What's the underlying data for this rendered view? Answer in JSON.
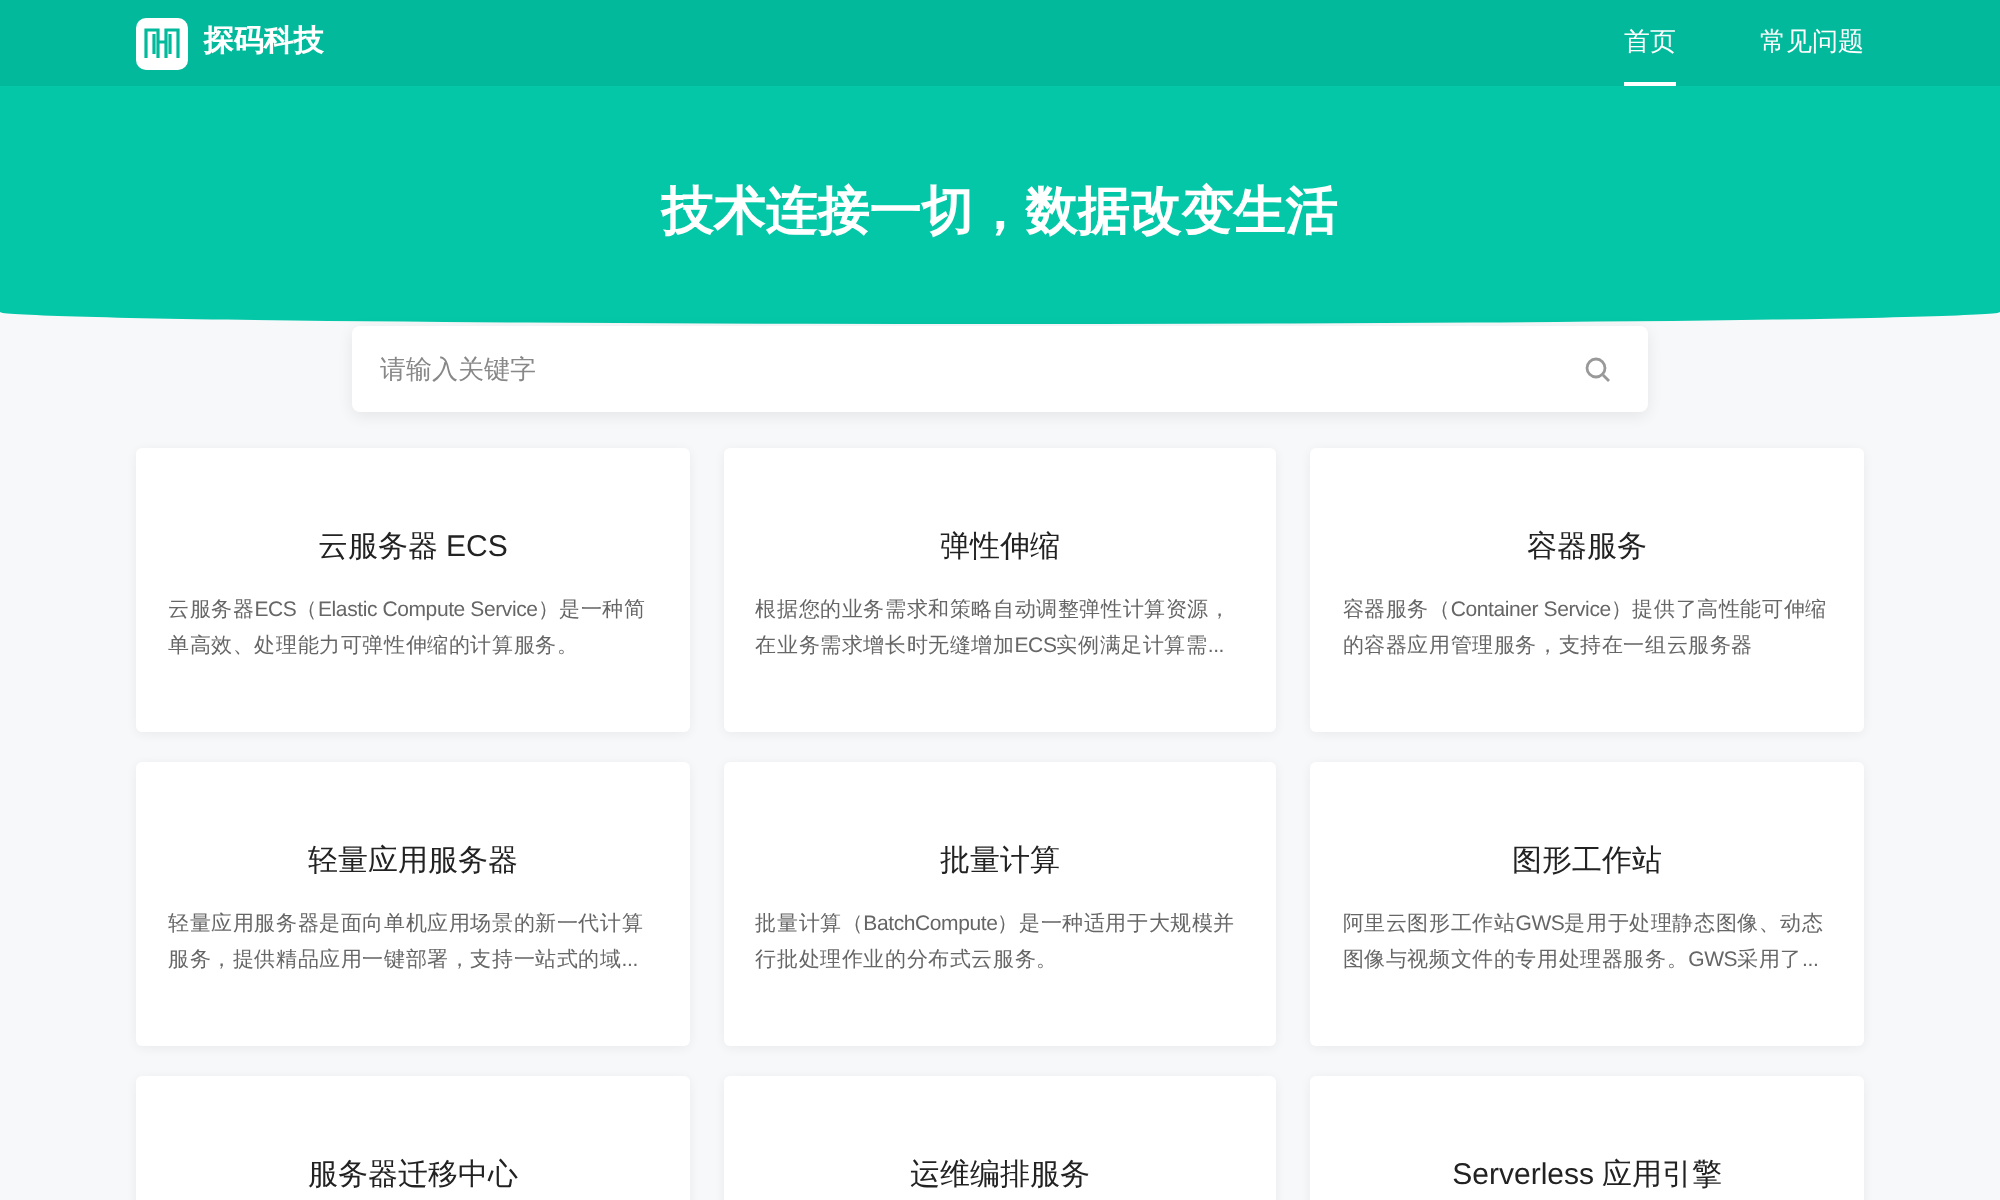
{
  "header": {
    "brand": "探码科技",
    "nav": [
      {
        "label": "首页",
        "selected": true
      },
      {
        "label": "常见问题",
        "selected": false
      }
    ]
  },
  "hero": {
    "title": "技术连接一切，数据改变生活"
  },
  "search": {
    "placeholder": "请输入关键字"
  },
  "cards": [
    {
      "title": "云服务器 ECS",
      "description": "云服务器ECS（Elastic Compute Service）是一种简单高效、处理能力可弹性伸缩的计算服务。"
    },
    {
      "title": "弹性伸缩",
      "description": "根据您的业务需求和策略自动调整弹性计算资源，在业务需求增长时无缝增加ECS实例满足计算需..."
    },
    {
      "title": "容器服务",
      "description": "容器服务（Container Service）提供了高性能可伸缩的容器应用管理服务，支持在一组云服务器"
    },
    {
      "title": "轻量应用服务器",
      "description": "轻量应用服务器是面向单机应用场景的新一代计算服务，提供精品应用一键部署，支持一站式的域..."
    },
    {
      "title": "批量计算",
      "description": "批量计算（BatchCompute）是一种适用于大规模并行批处理作业的分布式云服务。"
    },
    {
      "title": "图形工作站",
      "description": "阿里云图形工作站GWS是用于处理静态图像、动态图像与视频文件的专用处理器服务。GWS采用了..."
    },
    {
      "title": "服务器迁移中心"
    },
    {
      "title": "运维编排服务"
    },
    {
      "title": "Serverless 应用引擎"
    }
  ]
}
